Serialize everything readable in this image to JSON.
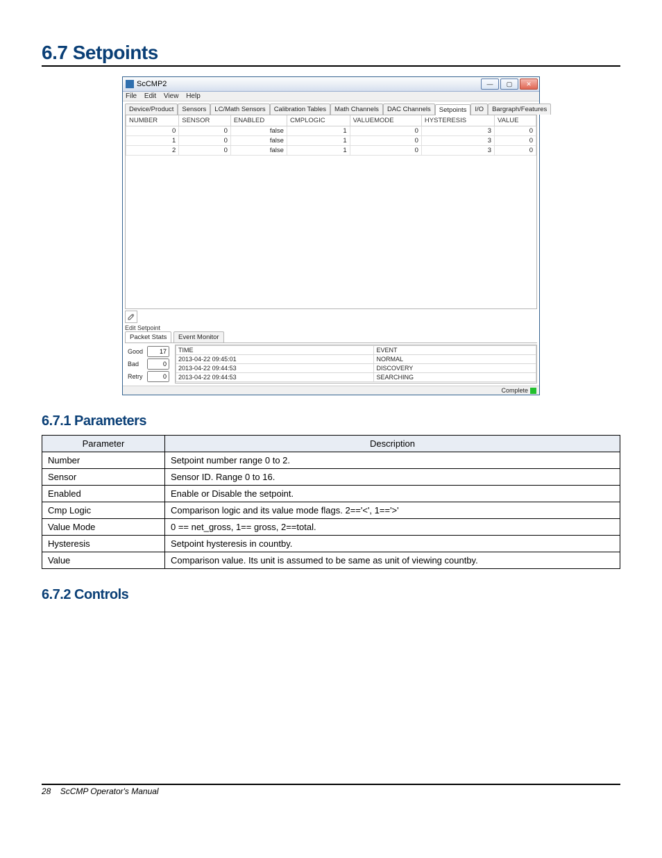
{
  "headings": {
    "section": "6.7   Setpoints",
    "parameters": "6.7.1   Parameters",
    "controls": "6.7.2   Controls"
  },
  "appwindow": {
    "title": "ScCMP2",
    "menus": [
      "File",
      "Edit",
      "View",
      "Help"
    ],
    "tabs": [
      "Device/Product",
      "Sensors",
      "LC/Math Sensors",
      "Calibration Tables",
      "Math Channels",
      "DAC Channels",
      "Setpoints",
      "I/O",
      "Bargraph/Features"
    ],
    "active_tab": 6,
    "columns": [
      "NUMBER",
      "SENSOR",
      "ENABLED",
      "CMPLOGIC",
      "VALUEMODE",
      "HYSTERESIS",
      "VALUE"
    ],
    "rows": [
      {
        "number": "0",
        "sensor": "0",
        "enabled": "false",
        "cmplogic": "1",
        "valuemode": "0",
        "hysteresis": "3",
        "value": "0"
      },
      {
        "number": "1",
        "sensor": "0",
        "enabled": "false",
        "cmplogic": "1",
        "valuemode": "0",
        "hysteresis": "3",
        "value": "0"
      },
      {
        "number": "2",
        "sensor": "0",
        "enabled": "false",
        "cmplogic": "1",
        "valuemode": "0",
        "hysteresis": "3",
        "value": "0"
      }
    ],
    "edit_button_label": "Edit Setpoint",
    "subtabs": [
      "Packet Stats",
      "Event Monitor"
    ],
    "stats": [
      {
        "label": "Good",
        "value": "17"
      },
      {
        "label": "Bad",
        "value": "0"
      },
      {
        "label": "Retry",
        "value": "0"
      }
    ],
    "event_columns": [
      "TIME",
      "EVENT"
    ],
    "events": [
      {
        "time": "2013-04-22 09:45:01",
        "event": "NORMAL"
      },
      {
        "time": "2013-04-22 09:44:53",
        "event": "DISCOVERY"
      },
      {
        "time": "2013-04-22 09:44:53",
        "event": "SEARCHING"
      }
    ],
    "status": "Complete",
    "winbuttons": {
      "min": "—",
      "max": "▢",
      "close": "✕"
    }
  },
  "param_table": {
    "headers": [
      "Parameter",
      "Description"
    ],
    "rows": [
      {
        "p": "Number",
        "d": "Setpoint number range 0 to 2."
      },
      {
        "p": "Sensor",
        "d": "Sensor ID. Range 0 to 16."
      },
      {
        "p": "Enabled",
        "d": "Enable or Disable the setpoint."
      },
      {
        "p": "Cmp Logic",
        "d": "Comparison logic and its value mode flags. 2=='<', 1=='>'"
      },
      {
        "p": "Value Mode",
        "d": "0 == net_gross, 1== gross, 2==total."
      },
      {
        "p": "Hysteresis",
        "d": "Setpoint hysteresis in countby."
      },
      {
        "p": "Value",
        "d": "Comparison value. Its unit is assumed to be same as unit of viewing countby."
      }
    ]
  },
  "footer": {
    "page": "28",
    "title": "ScCMP Operator's Manual"
  }
}
